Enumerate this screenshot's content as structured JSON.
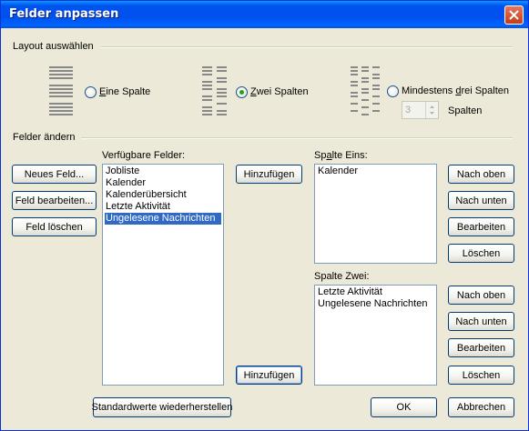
{
  "window": {
    "title": "Felder anpassen"
  },
  "layout_group": {
    "title": "Layout auswählen",
    "options": [
      {
        "pre": "",
        "key": "E",
        "post": "ine Spalte",
        "checked": false
      },
      {
        "pre": "",
        "key": "Z",
        "post": "wei Spalten",
        "checked": true
      },
      {
        "pre": "Mindestens ",
        "key": "d",
        "post": "rei Spalten",
        "checked": false
      }
    ],
    "spinner_value": "3",
    "spinner_unit": "Spalten"
  },
  "fields_group": {
    "title": "Felder ändern",
    "left_buttons": {
      "new": "Neues Feld...",
      "edit": "Feld bearbeiten...",
      "delete": "Feld löschen"
    },
    "available_label": "Verfügbare Felder:",
    "available_items": [
      "Jobliste",
      "Kalender",
      "Kalenderübersicht",
      "Letzte Aktivität",
      "Ungelesene Nachrichten"
    ],
    "add_label": "Hinzufügen",
    "col1": {
      "label_pre": "Sp",
      "label_key": "a",
      "label_post": "lte Eins:",
      "items": [
        "Kalender"
      ]
    },
    "col2": {
      "label": "Spalte Zwei:",
      "items": [
        "Letzte Aktivität",
        "Ungelesene Nachrichten"
      ]
    },
    "right_buttons": {
      "up": "Nach oben",
      "down": "Nach unten",
      "edit": "Bearbeiten",
      "delete": "Löschen"
    }
  },
  "footer": {
    "restore": "Standardwerte wiederherstellen",
    "ok": "OK",
    "cancel": "Abbrechen"
  },
  "colors": {
    "title_bar": "#0053ee",
    "selection": "#316ac5",
    "radio_dot": "#21a121"
  }
}
